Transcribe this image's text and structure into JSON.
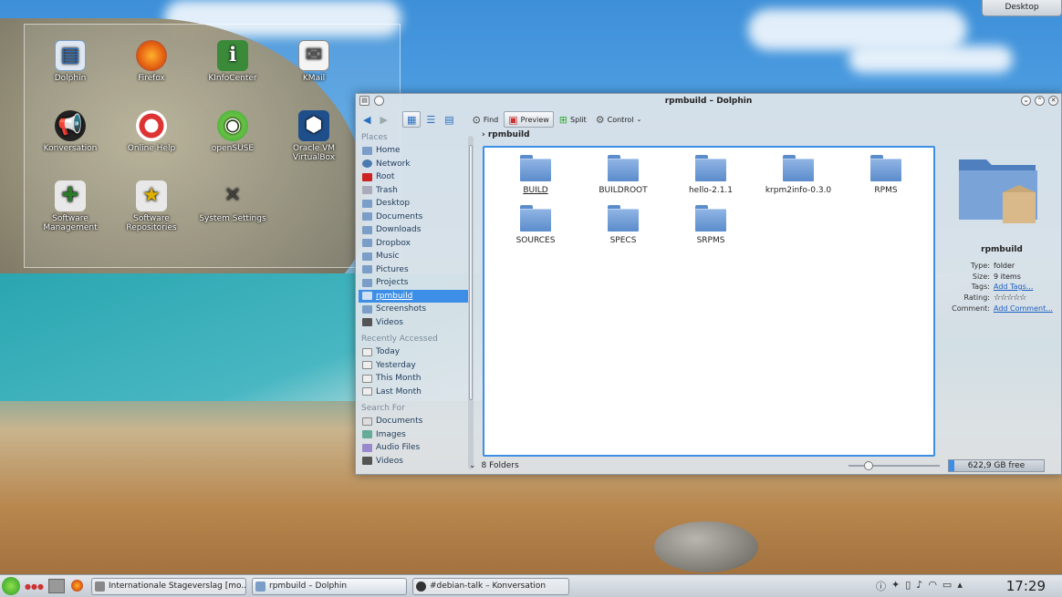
{
  "desktop_button": "Desktop",
  "desktop_icons": [
    {
      "label": "Dolphin",
      "icon": "dolphin-icon"
    },
    {
      "label": "Firefox",
      "icon": "firefox-icon"
    },
    {
      "label": "KInfoCenter",
      "icon": "kinfocenter-icon"
    },
    {
      "label": "KMail",
      "icon": "kmail-icon"
    },
    {
      "label": "Konversation",
      "icon": "konversation-icon"
    },
    {
      "label": "Online Help",
      "icon": "help-icon"
    },
    {
      "label": "openSUSE",
      "icon": "opensuse-icon"
    },
    {
      "label": "Oracle VM VirtualBox",
      "icon": "virtualbox-icon"
    },
    {
      "label": "Software Management",
      "icon": "software-management-icon"
    },
    {
      "label": "Software Repositories",
      "icon": "software-repositories-icon"
    },
    {
      "label": "System Settings",
      "icon": "system-settings-icon"
    }
  ],
  "window": {
    "title": "rpmbuild – Dolphin",
    "toolbar": {
      "find": "Find",
      "preview": "Preview",
      "split": "Split",
      "control": "Control"
    },
    "places_header": "Places",
    "places": [
      "Home",
      "Network",
      "Root",
      "Trash",
      "Desktop",
      "Documents",
      "Downloads",
      "Dropbox",
      "Music",
      "Pictures",
      "Projects",
      "rpmbuild",
      "Screenshots",
      "Videos"
    ],
    "recent_header": "Recently Accessed",
    "recent": [
      "Today",
      "Yesterday",
      "This Month",
      "Last Month"
    ],
    "search_header": "Search For",
    "search": [
      "Documents",
      "Images",
      "Audio Files",
      "Videos"
    ],
    "breadcrumb": "rpmbuild",
    "folders": [
      "BUILD",
      "BUILDROOT",
      "hello-2.1.1",
      "krpm2info-0.3.0",
      "RPMS",
      "SOURCES",
      "SPECS",
      "SRPMS"
    ],
    "status": "8 Folders",
    "free_space": "622,9 GB free",
    "info": {
      "name": "rpmbuild",
      "type_label": "Type:",
      "type": "folder",
      "size_label": "Size:",
      "size": "9 items",
      "tags_label": "Tags:",
      "tags": "Add Tags...",
      "rating_label": "Rating:",
      "rating": "☆☆☆☆☆",
      "comment_label": "Comment:",
      "comment": "Add Comment..."
    }
  },
  "taskbar": {
    "tasks": [
      "Internationale Stageverslag [mo...",
      "rpmbuild – Dolphin",
      "#debian-talk – Konversation"
    ],
    "clock": "17:29"
  },
  "colors": {
    "accent": "#3d8ee6",
    "folder": "#5b8ccc"
  }
}
